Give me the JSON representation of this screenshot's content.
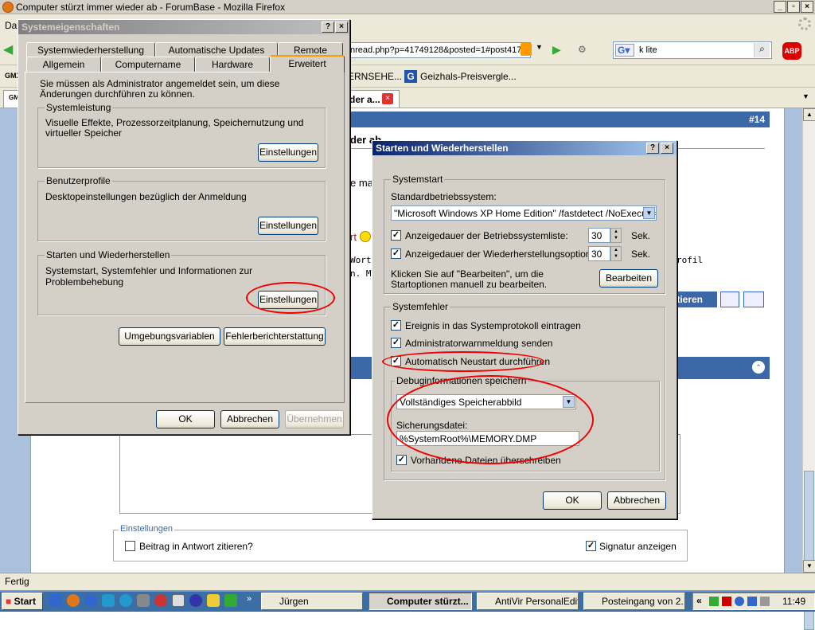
{
  "browser": {
    "title": "Computer stürzt immer wieder ab - ForumBase - Mozilla Firefox",
    "menu_partial": "Dat",
    "url": "nread.php?p=41749128&posted=1#post417",
    "search_engine": "G",
    "search_value": "k lite",
    "abp": "ABP",
    "bookmarks": [
      {
        "label": "GMX",
        "partial": true
      },
      {
        "label": "ERNSEHE..."
      },
      {
        "label": "Geizhals-Preisvergle..."
      }
    ],
    "tabs": [
      {
        "label": "GM"
      },
      {
        "label": "der a..."
      }
    ],
    "status": "Fertig"
  },
  "forum": {
    "post_number": "#14",
    "snippets": [
      "der ab",
      "e ma",
      "rt",
      "Wort.",
      "n. M.",
      "rofil"
    ],
    "quote_button": "itieren",
    "settings_legend": "Einstellungen",
    "quote_in_reply": "Beitrag in Antwort zitieren?",
    "show_signature": "Signatur anzeigen"
  },
  "sysprops": {
    "title": "Systemeigenschaften",
    "tabs_row1": [
      "Systemwiederherstellung",
      "Automatische Updates",
      "Remote"
    ],
    "tabs_row2": [
      "Allgemein",
      "Computername",
      "Hardware",
      "Erweitert"
    ],
    "admin_note": "Sie müssen als Administrator angemeldet sein, um diese Änderungen durchführen zu können.",
    "perf": {
      "legend": "Systemleistung",
      "text": "Visuelle Effekte, Prozessorzeitplanung, Speichernutzung und virtueller Speicher",
      "button": "Einstellungen"
    },
    "profiles": {
      "legend": "Benutzerprofile",
      "text": "Desktopeinstellungen bezüglich der Anmeldung",
      "button": "Einstellungen"
    },
    "startup": {
      "legend": "Starten und Wiederherstellen",
      "text": "Systemstart, Systemfehler und Informationen zur Problembehebung",
      "button": "Einstellungen"
    },
    "env_button": "Umgebungsvariablen",
    "error_button": "Fehlerberichterstattung",
    "ok": "OK",
    "cancel": "Abbrechen",
    "apply": "Übernehmen"
  },
  "startup_dialog": {
    "title": "Starten und Wiederherstellen",
    "systemstart_legend": "Systemstart",
    "default_os_label": "Standardbetriebssystem:",
    "default_os_value": "\"Microsoft Windows XP Home Edition\" /fastdetect /NoExecute=Op",
    "os_list_label": "Anzeigedauer der Betriebssystemliste:",
    "os_list_value": "30",
    "recovery_label": "Anzeigedauer der Wiederherstellungsoptionen:",
    "recovery_value": "30",
    "sec": "Sek.",
    "edit_note": "Klicken Sie auf \"Bearbeiten\", um die Startoptionen manuell zu bearbeiten.",
    "edit_button": "Bearbeiten",
    "syserr_legend": "Systemfehler",
    "write_event": "Ereignis in das Systemprotokoll eintragen",
    "admin_alert": "Administratorwarnmeldung senden",
    "auto_restart": "Automatisch Neustart durchführen",
    "debug_legend": "Debuginformationen speichern",
    "debug_value": "Vollständiges Speicherabbild",
    "dump_file_label": "Sicherungsdatei:",
    "dump_file_value": "%SystemRoot%\\MEMORY.DMP",
    "overwrite": "Vorhandene Dateien überschreiben",
    "ok": "OK",
    "cancel": "Abbrechen"
  },
  "taskbar": {
    "start": "Start",
    "items": [
      {
        "label": "Jürgen",
        "active": false
      },
      {
        "label": "Computer stürzt...",
        "active": true
      },
      {
        "label": "AntiVir PersonalEdit...",
        "active": false
      },
      {
        "label": "Posteingang von 2...",
        "active": false
      }
    ],
    "clock": "11:49"
  }
}
